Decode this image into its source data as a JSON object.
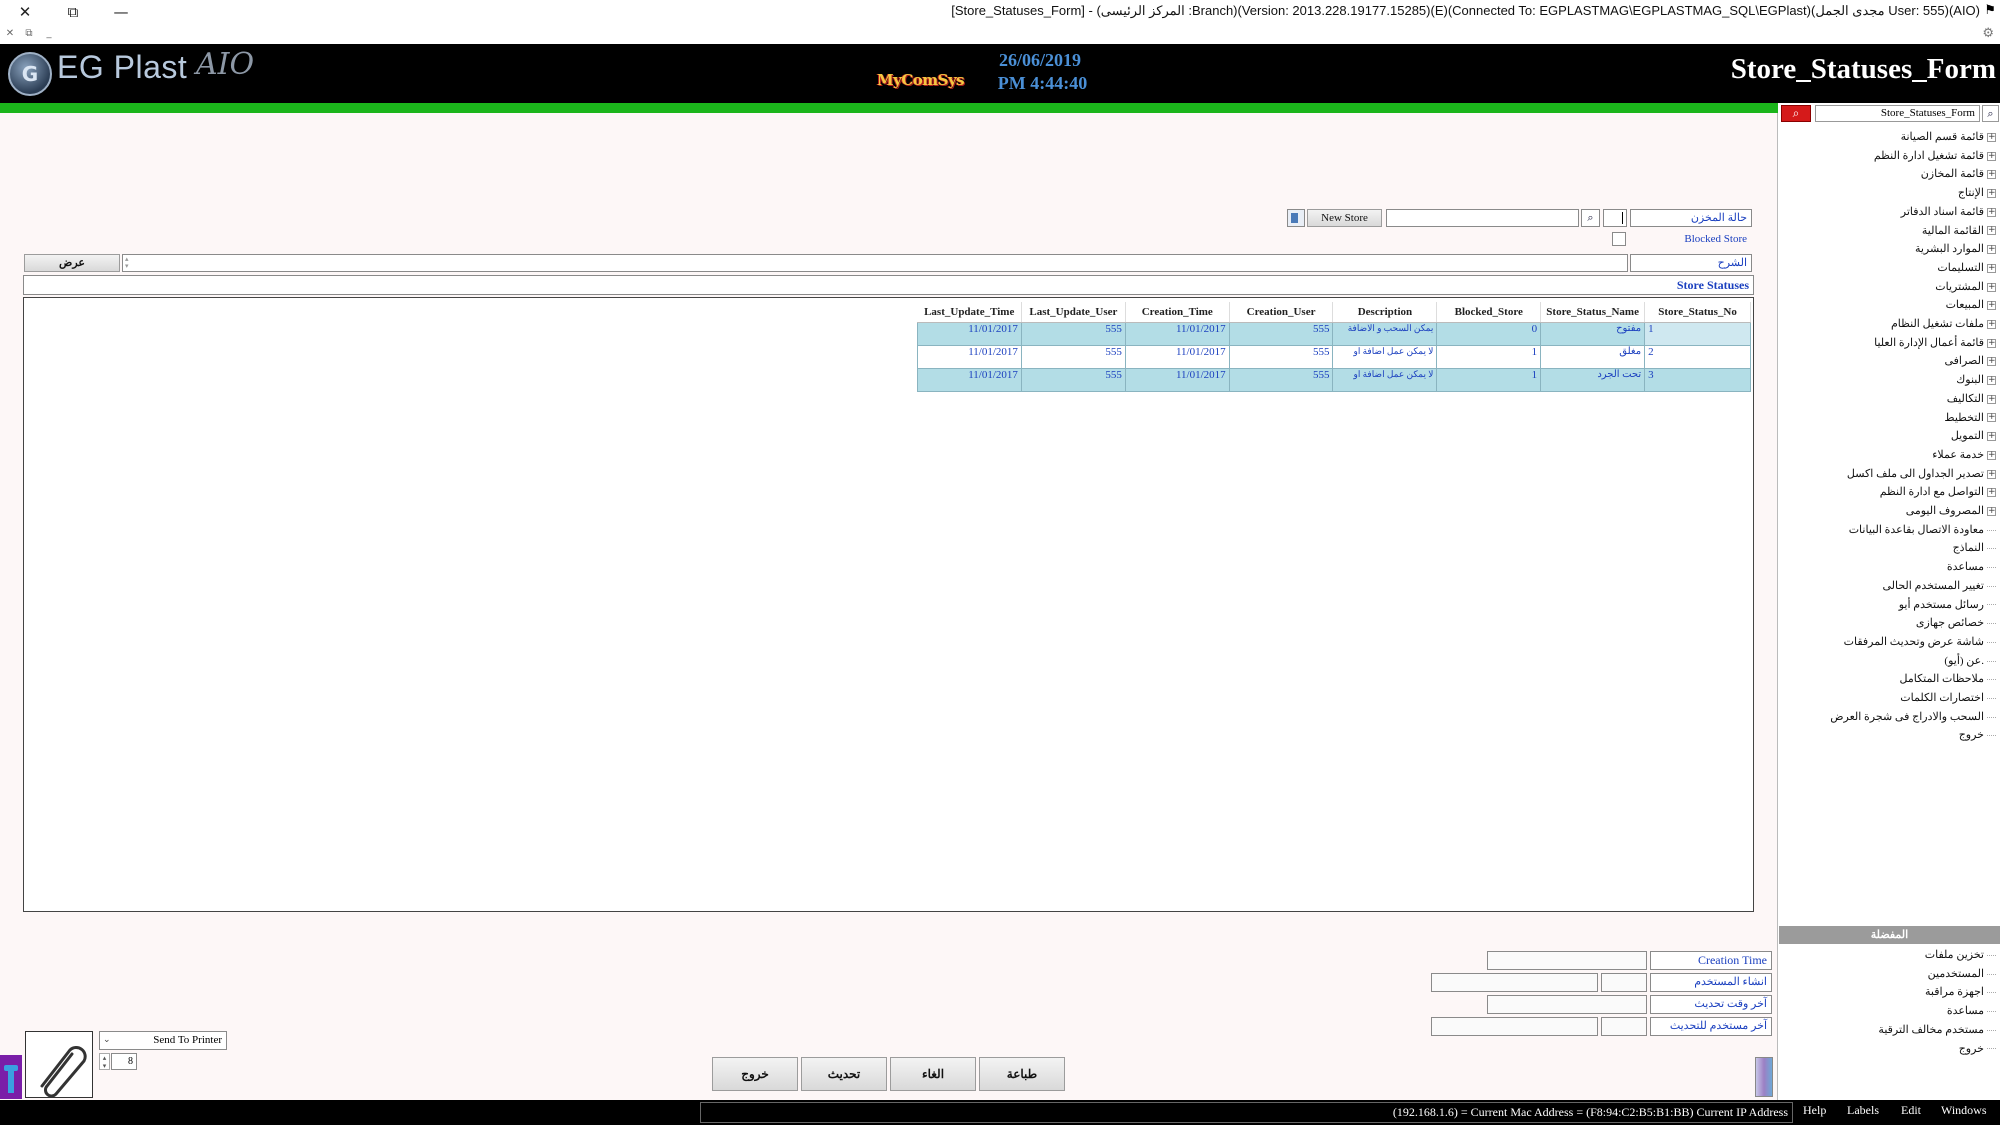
{
  "window": {
    "title": "[Store_Statuses_Form] - (المركز الرئيسى :Branch)(Version: 2013.228.19177.15285)(E)(Connected To: EGPLASTMAG\\EGPLASTMAG_SQL\\EGPlast)(مجدى الجمل User: 555)(AIO)",
    "controls": {
      "close": "✕",
      "restore": "⧉",
      "minimize": "—"
    },
    "sub_controls": {
      "close": "✕",
      "restore": "⧉",
      "minimize": "_"
    },
    "flag": "⚑",
    "gear": "⚙"
  },
  "header": {
    "logo_text": "EG Plast",
    "logo_aio": "AIO",
    "vendor": "MyComSys",
    "date": "26/06/2019",
    "time": "PM 4:44:40",
    "form_title": "Store_Statuses_Form"
  },
  "filters": {
    "store_status_label": "حالة المخزن",
    "new_store_button": "New Store",
    "blocked_store_label": "Blocked Store",
    "description_label": "الشرح",
    "view_button": "عرض"
  },
  "grid": {
    "caption": "Store Statuses",
    "columns": [
      "Last_Update_Time",
      "Last_Update_User",
      "Creation_Time",
      "Creation_User",
      "Description",
      "Blocked_Store",
      "Store_Status_Name",
      "Store_Status_No"
    ],
    "rows": [
      {
        "last_update_time": "11/01/2017",
        "last_update_user": "555",
        "creation_time": "11/01/2017",
        "creation_user": "555",
        "description": "يمكن السحب و الاضافة",
        "blocked_store": "0",
        "name": "مفتوح",
        "no": "1"
      },
      {
        "last_update_time": "11/01/2017",
        "last_update_user": "555",
        "creation_time": "11/01/2017",
        "creation_user": "555",
        "description": "لا يمكن عمل اضافة او",
        "blocked_store": "1",
        "name": "مغلق",
        "no": "2"
      },
      {
        "last_update_time": "11/01/2017",
        "last_update_user": "555",
        "creation_time": "11/01/2017",
        "creation_user": "555",
        "description": "لا يمكن عمل اضافة او",
        "blocked_store": "1",
        "name": "تحت الجرد",
        "no": "3"
      }
    ]
  },
  "audit": {
    "creation_time_label": "Creation Time",
    "creation_user_label": "انشاء المستخدم",
    "last_update_time_label": "آخر وقت تحديث",
    "last_update_user_label": "آخر مستخدم للتحديث"
  },
  "bottom": {
    "printer_option": "Send To Printer",
    "copies": "8",
    "buttons": {
      "print": "طباعة",
      "cancel": "الغاء",
      "refresh": "تحديث",
      "exit": "خروج"
    }
  },
  "sidebar": {
    "search_value": "Store_Statuses_Form",
    "tree": [
      {
        "label": "قائمة قسم الصيانة",
        "expandable": true
      },
      {
        "label": "قائمة تشغيل ادارة النظم",
        "expandable": true
      },
      {
        "label": "قائمة المخازن",
        "expandable": true
      },
      {
        "label": "الإنتاج",
        "expandable": true
      },
      {
        "label": "قائمة اسناد الدفاتر",
        "expandable": true
      },
      {
        "label": "القائمة المالية",
        "expandable": true
      },
      {
        "label": "الموارد البشرية",
        "expandable": true
      },
      {
        "label": "التسليمات",
        "expandable": true
      },
      {
        "label": "المشتريات",
        "expandable": true
      },
      {
        "label": "المبيعات",
        "expandable": true
      },
      {
        "label": "ملفات تشغيل النظام",
        "expandable": true
      },
      {
        "label": "قائمة أعمال الإدارة العليا",
        "expandable": true
      },
      {
        "label": "الصرافى",
        "expandable": true
      },
      {
        "label": "البنوك",
        "expandable": true
      },
      {
        "label": "التكاليف",
        "expandable": true
      },
      {
        "label": "التخطيط",
        "expandable": true
      },
      {
        "label": "التمويل",
        "expandable": true
      },
      {
        "label": "خدمة عملاء",
        "expandable": true
      },
      {
        "label": "تصدير الجداول الى ملف اكسل",
        "expandable": true
      },
      {
        "label": "التواصل مع ادارة النظم",
        "expandable": true
      },
      {
        "label": "المصروف اليومى",
        "expandable": true
      },
      {
        "label": "معاودة الاتصال بقاعدة البيانات",
        "expandable": false
      },
      {
        "label": "النماذج",
        "expandable": false
      },
      {
        "label": "مساعدة",
        "expandable": false
      },
      {
        "label": "تغيير المستخدم الحالى",
        "expandable": false
      },
      {
        "label": "رسائل مستخدم أيو",
        "expandable": false
      },
      {
        "label": "خصائص جهازى",
        "expandable": false
      },
      {
        "label": "شاشة عرض وتحديث المرفقات",
        "expandable": false
      },
      {
        "label": "عن (أيو).",
        "expandable": false
      },
      {
        "label": "ملاحظات المتكامل",
        "expandable": false
      },
      {
        "label": "اختصارات الكلمات",
        "expandable": false
      },
      {
        "label": "السحب والادراج فى شجرة العرض",
        "expandable": false
      },
      {
        "label": "خروج",
        "expandable": false
      }
    ],
    "favorites_header": "المفضلة",
    "favorites": [
      {
        "label": "تخزين ملفات"
      },
      {
        "label": "المستخدمين"
      },
      {
        "label": "اجهزة مراقبة"
      },
      {
        "label": "مساعدة"
      },
      {
        "label": "مستخدم مخالف الترقية"
      },
      {
        "label": "خروج"
      }
    ]
  },
  "statusbar": {
    "text": "(192.168.1.6) = Current Mac Address = (F8:94:C2:B5:B1:BB) Current IP Address",
    "menu": [
      "Help",
      "Labels",
      "Edit",
      "Windows"
    ]
  },
  "colors": {
    "header_bg": "#000000",
    "accent_green": "#1bb51b",
    "date_blue": "#4a8fd6",
    "grid_row_blue": "#b3dde6",
    "search_red": "#d51a1a"
  }
}
